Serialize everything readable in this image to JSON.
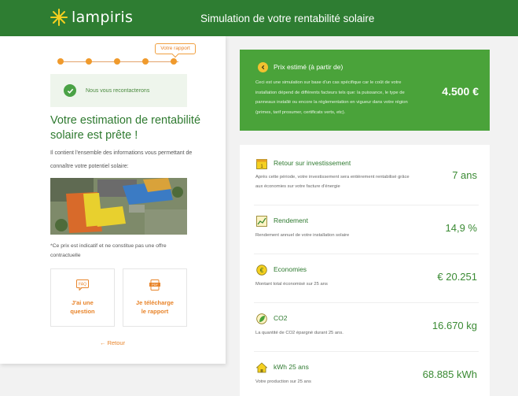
{
  "header": {
    "logo_text": "lampiris",
    "title": "Simulation de votre rentabilité solaire"
  },
  "progress": {
    "steps": 5,
    "tooltip": "Votre rapport"
  },
  "notice": {
    "text": "Nous vous recontacterons"
  },
  "estimate": {
    "title": "Votre estimation de rentabilité solaire est prête !",
    "description": "Il contient l'ensemble des informations vous permettant de connaître votre potentiel solaire:",
    "disclaimer": "*Ce prix est indicatif et ne constitue pas une offre contractuelle"
  },
  "actions": [
    {
      "label": "J'ai une question",
      "icon": "faq-icon",
      "icon_text": "FAQ"
    },
    {
      "label": "Je télécharge le rapport",
      "icon": "pdf-download-icon",
      "icon_text": "PDF"
    }
  ],
  "back_link": "←  Retour",
  "price": {
    "title": "Prix estimé (à partir de)",
    "description": "Ceci est une simulation sur base d'un cas spécifique car le coût de votre installation dépend de différents facteurs tels que: la puissance, le type de panneaux installé ou encore la réglementation en vigueur dans votre région (primes, tarif prosumer, certificats verts, etc).",
    "value": "4.500 €"
  },
  "results": [
    {
      "title": "Retour sur investissement",
      "description": "Après cette période, votre investissement sera entièrement rentabilisé grâce aux économies sur votre facture d'énergie",
      "value": "7 ans",
      "icon": "calendar-icon"
    },
    {
      "title": "Rendement",
      "description": "Rendement annuel de votre installation solaire",
      "value": "14,9 %",
      "icon": "chart-icon"
    },
    {
      "title": "Economies",
      "description": "Montant total économisé sur 25 ans",
      "value": "€ 20.251",
      "icon": "savings-icon"
    },
    {
      "title": "CO2",
      "description": "La quantité de CO2 épargné durant 25 ans.",
      "value": "16.670 kg",
      "icon": "leaf-icon"
    },
    {
      "title": "kWh 25 ans",
      "description": "Votre production sur 25 ans",
      "value": "68.885 kWh",
      "icon": "house-icon"
    }
  ],
  "colors": {
    "brand_green": "#2e7d32",
    "accent_orange": "#f09a2c",
    "price_green": "#4aa33a"
  }
}
